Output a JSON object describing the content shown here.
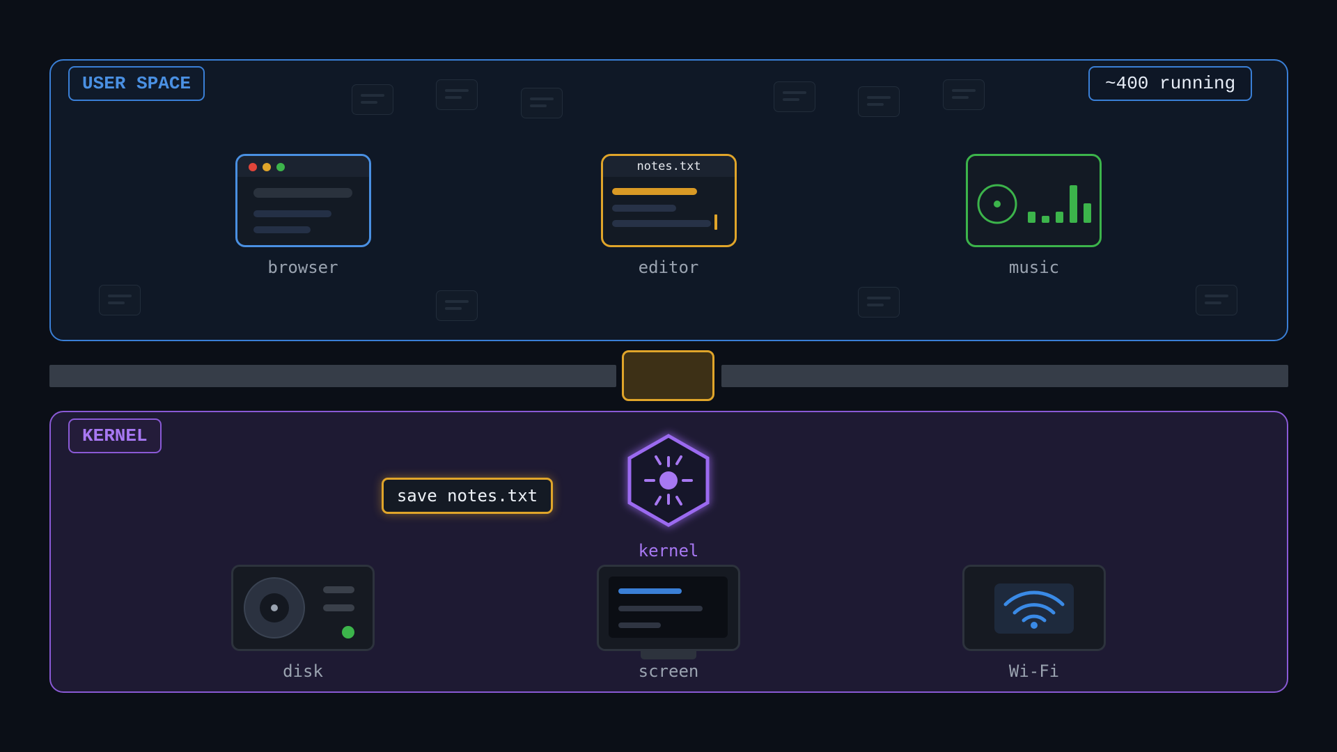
{
  "user_space": {
    "tag": "USER SPACE",
    "process_count": "~400 running",
    "apps": {
      "browser": {
        "label": "browser"
      },
      "editor": {
        "label": "editor",
        "file_name": "notes.txt"
      },
      "music": {
        "label": "music"
      }
    }
  },
  "kernel": {
    "tag": "KERNEL",
    "core_label": "kernel",
    "request_message": "save notes.txt",
    "devices": {
      "disk": {
        "label": "disk"
      },
      "screen": {
        "label": "screen"
      },
      "wifi": {
        "label": "Wi-Fi"
      }
    }
  },
  "colors": {
    "user_space_accent": "#3a7fd6",
    "kernel_accent": "#8a5ad6",
    "editor_accent": "#e0a52a",
    "music_accent": "#3cb44b",
    "background": "#0b0f17"
  }
}
